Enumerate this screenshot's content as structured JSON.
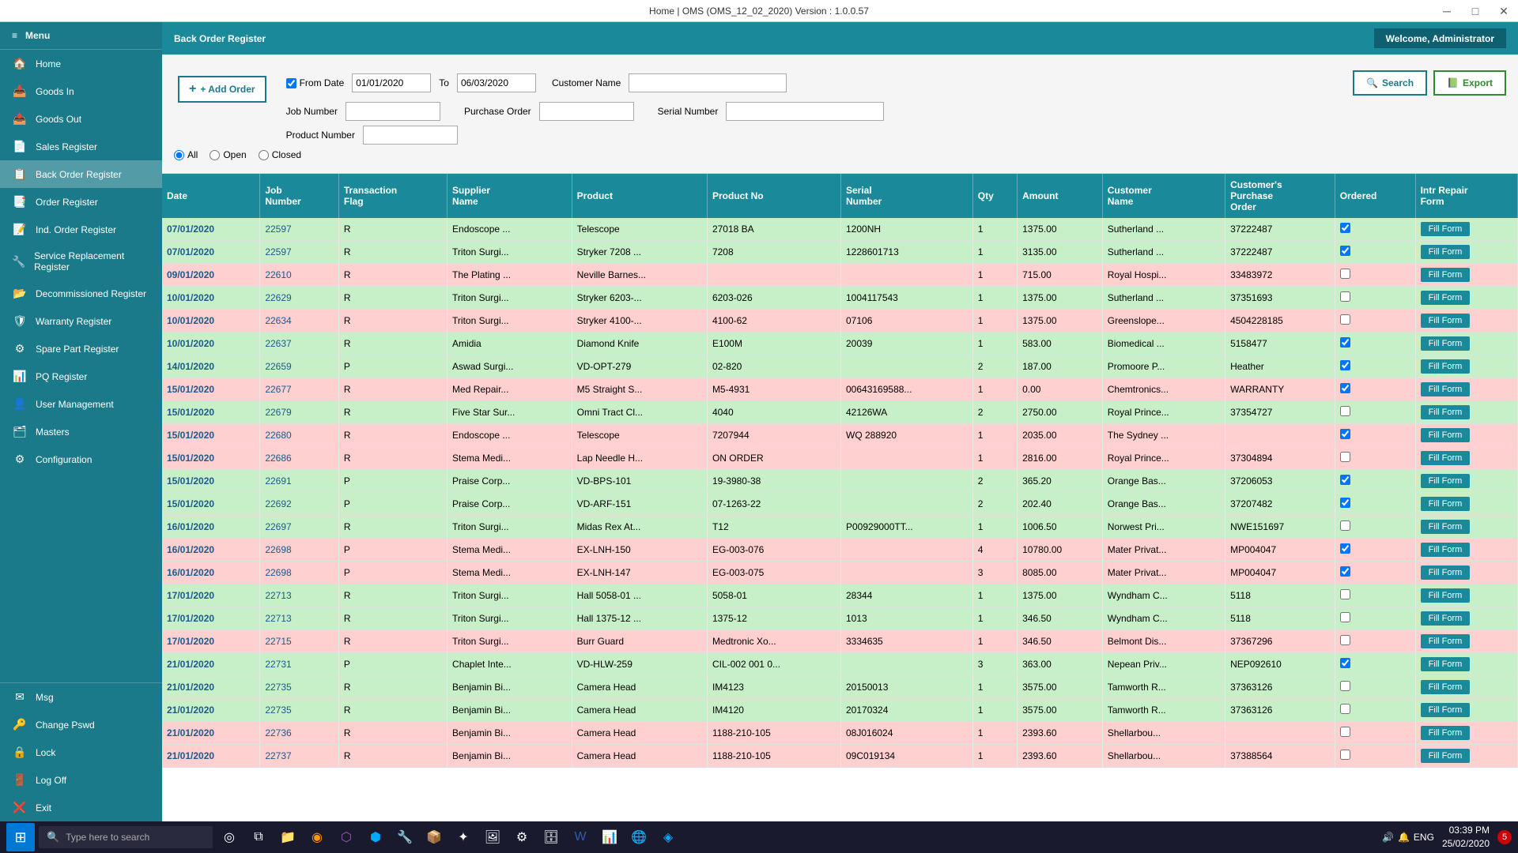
{
  "titlebar": {
    "title": "Home | OMS (OMS_12_02_2020)  Version : 1.0.0.57"
  },
  "header": {
    "page_title": "Back Order Register",
    "welcome": "Welcome, Administrator"
  },
  "sidebar": {
    "menu_label": "Menu",
    "items": [
      {
        "id": "home",
        "label": "Home",
        "icon": "🏠"
      },
      {
        "id": "goods-in",
        "label": "Goods In",
        "icon": "📥"
      },
      {
        "id": "goods-out",
        "label": "Goods Out",
        "icon": "📤"
      },
      {
        "id": "sales-register",
        "label": "Sales Register",
        "icon": "📄"
      },
      {
        "id": "back-order-register",
        "label": "Back Order Register",
        "icon": "📋"
      },
      {
        "id": "order-register",
        "label": "Order Register",
        "icon": "📑"
      },
      {
        "id": "ind-order-register",
        "label": "Ind. Order Register",
        "icon": "📝"
      },
      {
        "id": "service-replacement-register",
        "label": "Service Replacement Register",
        "icon": "🔧"
      },
      {
        "id": "decommissioned-register",
        "label": "Decommissioned Register",
        "icon": "📂"
      },
      {
        "id": "warranty-register",
        "label": "Warranty Register",
        "icon": "🛡"
      },
      {
        "id": "spare-part-register",
        "label": "Spare Part Register",
        "icon": "⚙"
      },
      {
        "id": "pq-register",
        "label": "PQ Register",
        "icon": "📊"
      },
      {
        "id": "user-management",
        "label": "User Management",
        "icon": "👤"
      },
      {
        "id": "masters",
        "label": "Masters",
        "icon": "🗂"
      },
      {
        "id": "configuration",
        "label": "Configuration",
        "icon": "⚙"
      }
    ],
    "bottom_items": [
      {
        "id": "msg",
        "label": "Msg",
        "icon": "✉"
      },
      {
        "id": "change-pswd",
        "label": "Change Pswd",
        "icon": "🔑"
      },
      {
        "id": "lock",
        "label": "Lock",
        "icon": "🔒"
      },
      {
        "id": "log-off",
        "label": "Log Off",
        "icon": "🚪"
      },
      {
        "id": "exit",
        "label": "Exit",
        "icon": "❌"
      }
    ]
  },
  "filters": {
    "from_date_checked": true,
    "from_date": "01/01/2020",
    "to_date": "06/03/2020",
    "customer_name_label": "Customer Name",
    "customer_name_value": "",
    "job_number_label": "Job Number",
    "job_number_value": "",
    "purchase_order_label": "Purchase Order",
    "purchase_order_value": "",
    "serial_number_label": "Serial Number",
    "serial_number_value": "",
    "product_number_label": "Product Number",
    "product_number_value": "",
    "add_order_label": "+ Add Order",
    "search_label": "Search",
    "export_label": "Export",
    "radio_all": "All",
    "radio_open": "Open",
    "radio_closed": "Closed"
  },
  "table": {
    "columns": [
      "Date",
      "Job Number",
      "Transaction Flag",
      "Supplier Name",
      "Product",
      "Product No",
      "Serial Number",
      "Qty",
      "Amount",
      "Customer Name",
      "Customer's Purchase Order",
      "Ordered",
      "Intr Repair Form"
    ],
    "rows": [
      {
        "color": "green",
        "date": "07/01/2020",
        "job": "22597",
        "flag": "R",
        "supplier": "Endoscope ...",
        "product": "Telescope",
        "product_no": "27018 BA",
        "serial": "1200NH",
        "qty": "1",
        "amount": "1375.00",
        "customer": "Sutherland ...",
        "cpo": "37222487",
        "ordered": true,
        "fill": "Fill Form"
      },
      {
        "color": "green",
        "date": "07/01/2020",
        "job": "22597",
        "flag": "R",
        "supplier": "Triton Surgi...",
        "product": "Stryker 7208 ...",
        "product_no": "7208",
        "serial": "1228601713",
        "qty": "1",
        "amount": "3135.00",
        "customer": "Sutherland ...",
        "cpo": "37222487",
        "ordered": true,
        "fill": "Fill Form"
      },
      {
        "color": "pink",
        "date": "09/01/2020",
        "job": "22610",
        "flag": "R",
        "supplier": "The Plating ...",
        "product": "Neville Barnes...",
        "product_no": "",
        "serial": "",
        "qty": "1",
        "amount": "715.00",
        "customer": "Royal Hospi...",
        "cpo": "33483972",
        "ordered": false,
        "fill": "Fill Form"
      },
      {
        "color": "green",
        "date": "10/01/2020",
        "job": "22629",
        "flag": "R",
        "supplier": "Triton Surgi...",
        "product": "Stryker 6203-...",
        "product_no": "6203-026",
        "serial": "1004117543",
        "qty": "1",
        "amount": "1375.00",
        "customer": "Sutherland ...",
        "cpo": "37351693",
        "ordered": false,
        "fill": "Fill Form"
      },
      {
        "color": "pink",
        "date": "10/01/2020",
        "job": "22634",
        "flag": "R",
        "supplier": "Triton Surgi...",
        "product": "Stryker 4100-...",
        "product_no": "4100-62",
        "serial": "07106",
        "qty": "1",
        "amount": "1375.00",
        "customer": "Greenslope...",
        "cpo": "4504228185",
        "ordered": false,
        "fill": "Fill Form"
      },
      {
        "color": "green",
        "date": "10/01/2020",
        "job": "22637",
        "flag": "R",
        "supplier": "Amidia",
        "product": "Diamond Knife",
        "product_no": "E100M",
        "serial": "20039",
        "qty": "1",
        "amount": "583.00",
        "customer": "Biomedical ...",
        "cpo": "5158477",
        "ordered": true,
        "fill": "Fill Form"
      },
      {
        "color": "green",
        "date": "14/01/2020",
        "job": "22659",
        "flag": "P",
        "supplier": "Aswad Surgi...",
        "product": "VD-OPT-279",
        "product_no": "02-820",
        "serial": "",
        "qty": "2",
        "amount": "187.00",
        "customer": "Promoore P...",
        "cpo": "Heather",
        "ordered": true,
        "fill": "Fill Form"
      },
      {
        "color": "pink",
        "date": "15/01/2020",
        "job": "22677",
        "flag": "R",
        "supplier": "Med Repair...",
        "product": "M5 Straight S...",
        "product_no": "M5-4931",
        "serial": "00643169588...",
        "qty": "1",
        "amount": "0.00",
        "customer": "Chemtronics...",
        "cpo": "WARRANTY",
        "ordered": true,
        "fill": "Fill Form"
      },
      {
        "color": "green",
        "date": "15/01/2020",
        "job": "22679",
        "flag": "R",
        "supplier": "Five Star Sur...",
        "product": "Omni Tract Cl...",
        "product_no": "4040",
        "serial": "42126WA",
        "qty": "2",
        "amount": "2750.00",
        "customer": "Royal Prince...",
        "cpo": "37354727",
        "ordered": false,
        "fill": "Fill Form"
      },
      {
        "color": "pink",
        "date": "15/01/2020",
        "job": "22680",
        "flag": "R",
        "supplier": "Endoscope ...",
        "product": "Telescope",
        "product_no": "7207944",
        "serial": "WQ 288920",
        "qty": "1",
        "amount": "2035.00",
        "customer": "The Sydney ...",
        "cpo": "",
        "ordered": true,
        "fill": "Fill Form"
      },
      {
        "color": "pink",
        "date": "15/01/2020",
        "job": "22686",
        "flag": "R",
        "supplier": "Stema Medi...",
        "product": "Lap Needle H...",
        "product_no": "ON ORDER",
        "serial": "",
        "qty": "1",
        "amount": "2816.00",
        "customer": "Royal Prince...",
        "cpo": "37304894",
        "ordered": false,
        "fill": "Fill Form"
      },
      {
        "color": "green",
        "date": "15/01/2020",
        "job": "22691",
        "flag": "P",
        "supplier": "Praise Corp...",
        "product": "VD-BPS-101",
        "product_no": "19-3980-38",
        "serial": "",
        "qty": "2",
        "amount": "365.20",
        "customer": "Orange Bas...",
        "cpo": "37206053",
        "ordered": true,
        "fill": "Fill Form"
      },
      {
        "color": "green",
        "date": "15/01/2020",
        "job": "22692",
        "flag": "P",
        "supplier": "Praise Corp...",
        "product": "VD-ARF-151",
        "product_no": "07-1263-22",
        "serial": "",
        "qty": "2",
        "amount": "202.40",
        "customer": "Orange Bas...",
        "cpo": "37207482",
        "ordered": true,
        "fill": "Fill Form"
      },
      {
        "color": "green",
        "date": "16/01/2020",
        "job": "22697",
        "flag": "R",
        "supplier": "Triton Surgi...",
        "product": "Midas Rex At...",
        "product_no": "T12",
        "serial": "P00929000TT...",
        "qty": "1",
        "amount": "1006.50",
        "customer": "Norwest Pri...",
        "cpo": "NWE151697",
        "ordered": false,
        "fill": "Fill Form"
      },
      {
        "color": "pink",
        "date": "16/01/2020",
        "job": "22698",
        "flag": "P",
        "supplier": "Stema Medi...",
        "product": "EX-LNH-150",
        "product_no": "EG-003-076",
        "serial": "",
        "qty": "4",
        "amount": "10780.00",
        "customer": "Mater Privat...",
        "cpo": "MP004047",
        "ordered": true,
        "fill": "Fill Form"
      },
      {
        "color": "pink",
        "date": "16/01/2020",
        "job": "22698",
        "flag": "P",
        "supplier": "Stema Medi...",
        "product": "EX-LNH-147",
        "product_no": "EG-003-075",
        "serial": "",
        "qty": "3",
        "amount": "8085.00",
        "customer": "Mater Privat...",
        "cpo": "MP004047",
        "ordered": true,
        "fill": "Fill Form"
      },
      {
        "color": "green",
        "date": "17/01/2020",
        "job": "22713",
        "flag": "R",
        "supplier": "Triton Surgi...",
        "product": "Hall 5058-01 ...",
        "product_no": "5058-01",
        "serial": "28344",
        "qty": "1",
        "amount": "1375.00",
        "customer": "Wyndham C...",
        "cpo": "5118",
        "ordered": false,
        "fill": "Fill Form"
      },
      {
        "color": "green",
        "date": "17/01/2020",
        "job": "22713",
        "flag": "R",
        "supplier": "Triton Surgi...",
        "product": "Hall 1375-12 ...",
        "product_no": "1375-12",
        "serial": "1013",
        "qty": "1",
        "amount": "346.50",
        "customer": "Wyndham C...",
        "cpo": "5118",
        "ordered": false,
        "fill": "Fill Form"
      },
      {
        "color": "pink",
        "date": "17/01/2020",
        "job": "22715",
        "flag": "R",
        "supplier": "Triton Surgi...",
        "product": "Burr Guard",
        "product_no": "Medtronic Xo...",
        "serial": "3334635",
        "qty": "1",
        "amount": "346.50",
        "customer": "Belmont Dis...",
        "cpo": "37367296",
        "ordered": false,
        "fill": "Fill Form"
      },
      {
        "color": "green",
        "date": "21/01/2020",
        "job": "22731",
        "flag": "P",
        "supplier": "Chaplet Inte...",
        "product": "VD-HLW-259",
        "product_no": "CIL-002 001 0...",
        "serial": "",
        "qty": "3",
        "amount": "363.00",
        "customer": "Nepean Priv...",
        "cpo": "NEP092610",
        "ordered": true,
        "fill": "Fill Form"
      },
      {
        "color": "green",
        "date": "21/01/2020",
        "job": "22735",
        "flag": "R",
        "supplier": "Benjamin Bi...",
        "product": "Camera Head",
        "product_no": "IM4123",
        "serial": "20150013",
        "qty": "1",
        "amount": "3575.00",
        "customer": "Tamworth R...",
        "cpo": "37363126",
        "ordered": false,
        "fill": "Fill Form"
      },
      {
        "color": "green",
        "date": "21/01/2020",
        "job": "22735",
        "flag": "R",
        "supplier": "Benjamin Bi...",
        "product": "Camera Head",
        "product_no": "IM4120",
        "serial": "20170324",
        "qty": "1",
        "amount": "3575.00",
        "customer": "Tamworth R...",
        "cpo": "37363126",
        "ordered": false,
        "fill": "Fill Form"
      },
      {
        "color": "pink",
        "date": "21/01/2020",
        "job": "22736",
        "flag": "R",
        "supplier": "Benjamin Bi...",
        "product": "Camera Head",
        "product_no": "1188-210-105",
        "serial": "08J016024",
        "qty": "1",
        "amount": "2393.60",
        "customer": "Shellarbou...",
        "cpo": "",
        "ordered": false,
        "fill": "Fill Form"
      },
      {
        "color": "pink",
        "date": "21/01/2020",
        "job": "22737",
        "flag": "R",
        "supplier": "Benjamin Bi...",
        "product": "Camera Head",
        "product_no": "1188-210-105",
        "serial": "09C019134",
        "qty": "1",
        "amount": "2393.60",
        "customer": "Shellarbou...",
        "cpo": "37388564",
        "ordered": false,
        "fill": "Fill Form"
      }
    ]
  },
  "taskbar": {
    "search_placeholder": "Type here to search",
    "time": "03:39 PM",
    "date": "25/02/2020",
    "lang": "ENG"
  }
}
